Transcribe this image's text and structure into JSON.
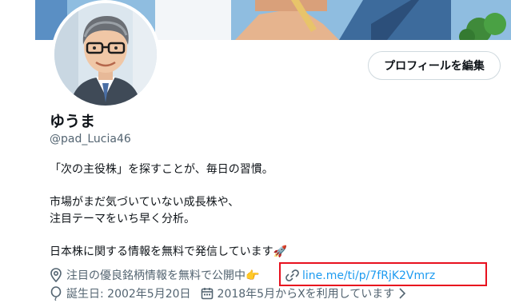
{
  "profile": {
    "edit_button_label": "プロフィールを編集",
    "display_name": "ゆうま",
    "handle": "@pad_Lucia46",
    "bio_lines": [
      "「次の主役株」を探すことが、毎日の習慣。",
      "市場がまだ気づいていない成長株や、",
      "注目テーマをいち早く分析。",
      "日本株に関する情報を無料で発信しています🚀"
    ]
  },
  "meta": {
    "location": "注目の優良銘柄情報を無料で公開中👉",
    "website": "line.me/ti/p/7fRjK2Vmrz",
    "birthday": "誕生日: 2002年5月20日",
    "joined": "2018年5月からXを利用しています"
  },
  "colors": {
    "link": "#1d9bf0",
    "highlight_box": "#e8101e",
    "secondary_text": "#536471"
  }
}
